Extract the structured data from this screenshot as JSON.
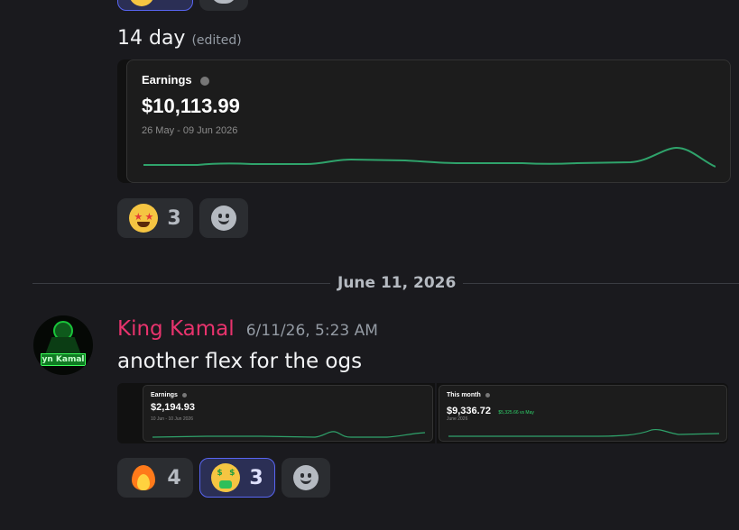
{
  "previous_message": {
    "text": "14 day",
    "edited_label": "(edited)",
    "card": {
      "title": "Earnings",
      "amount": "$10,113.99",
      "date_range": "26 May - 09 Jun 2026",
      "line_color": "#2fa36b"
    },
    "reactions": [
      {
        "emoji": "star-struck-emoji",
        "count": "3",
        "active": false
      },
      {
        "emoji": "add-reaction-icon",
        "count": null,
        "active": false
      }
    ]
  },
  "date_divider": "June 11, 2026",
  "message": {
    "author": "King Kamal",
    "author_color": "#e8336d",
    "timestamp": "6/11/26, 5:23 AM",
    "avatar_text": "yn Kamal",
    "text": "another flex for the ogs",
    "cards": [
      {
        "title": "Earnings",
        "amount": "$2,194.93",
        "date_range": "10 Jun - 10 Jun 2026",
        "badge": ""
      },
      {
        "title": "This month",
        "amount": "$9,336.72",
        "badge": "$5,325.66 vs May",
        "date_range": "June 2026"
      }
    ],
    "reactions": [
      {
        "emoji": "fire-emoji",
        "count": "4",
        "active": false
      },
      {
        "emoji": "money-mouth-emoji",
        "count": "3",
        "active": true
      },
      {
        "emoji": "add-reaction-icon",
        "count": null,
        "active": false
      }
    ]
  }
}
